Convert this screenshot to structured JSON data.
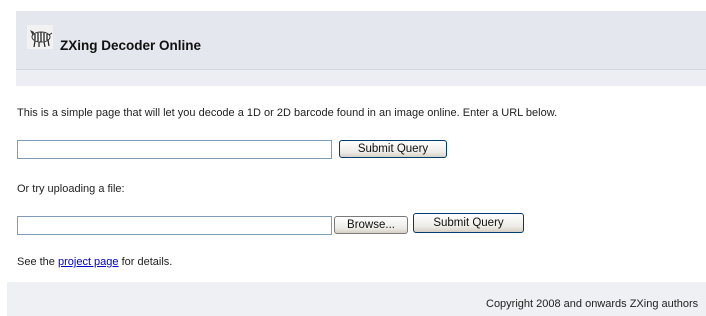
{
  "header": {
    "title": "ZXing Decoder Online",
    "logo_icon": "zebra-logo-icon"
  },
  "intro": "This is a simple page that will let you decode a 1D or 2D barcode found in an image online. Enter a URL below.",
  "url_form": {
    "value": "",
    "submit_label": "Submit Query"
  },
  "upload_form": {
    "prompt": "Or try uploading a file:",
    "value": "",
    "browse_label": "Browse...",
    "submit_label": "Submit Query"
  },
  "details": {
    "prefix": "See the ",
    "link_text": "project page",
    "suffix": " for details."
  },
  "footer": {
    "copyright": "Copyright 2008 and onwards ZXing authors"
  },
  "colors": {
    "header_bg": "#e4e7ee",
    "link": "#0000cc"
  }
}
